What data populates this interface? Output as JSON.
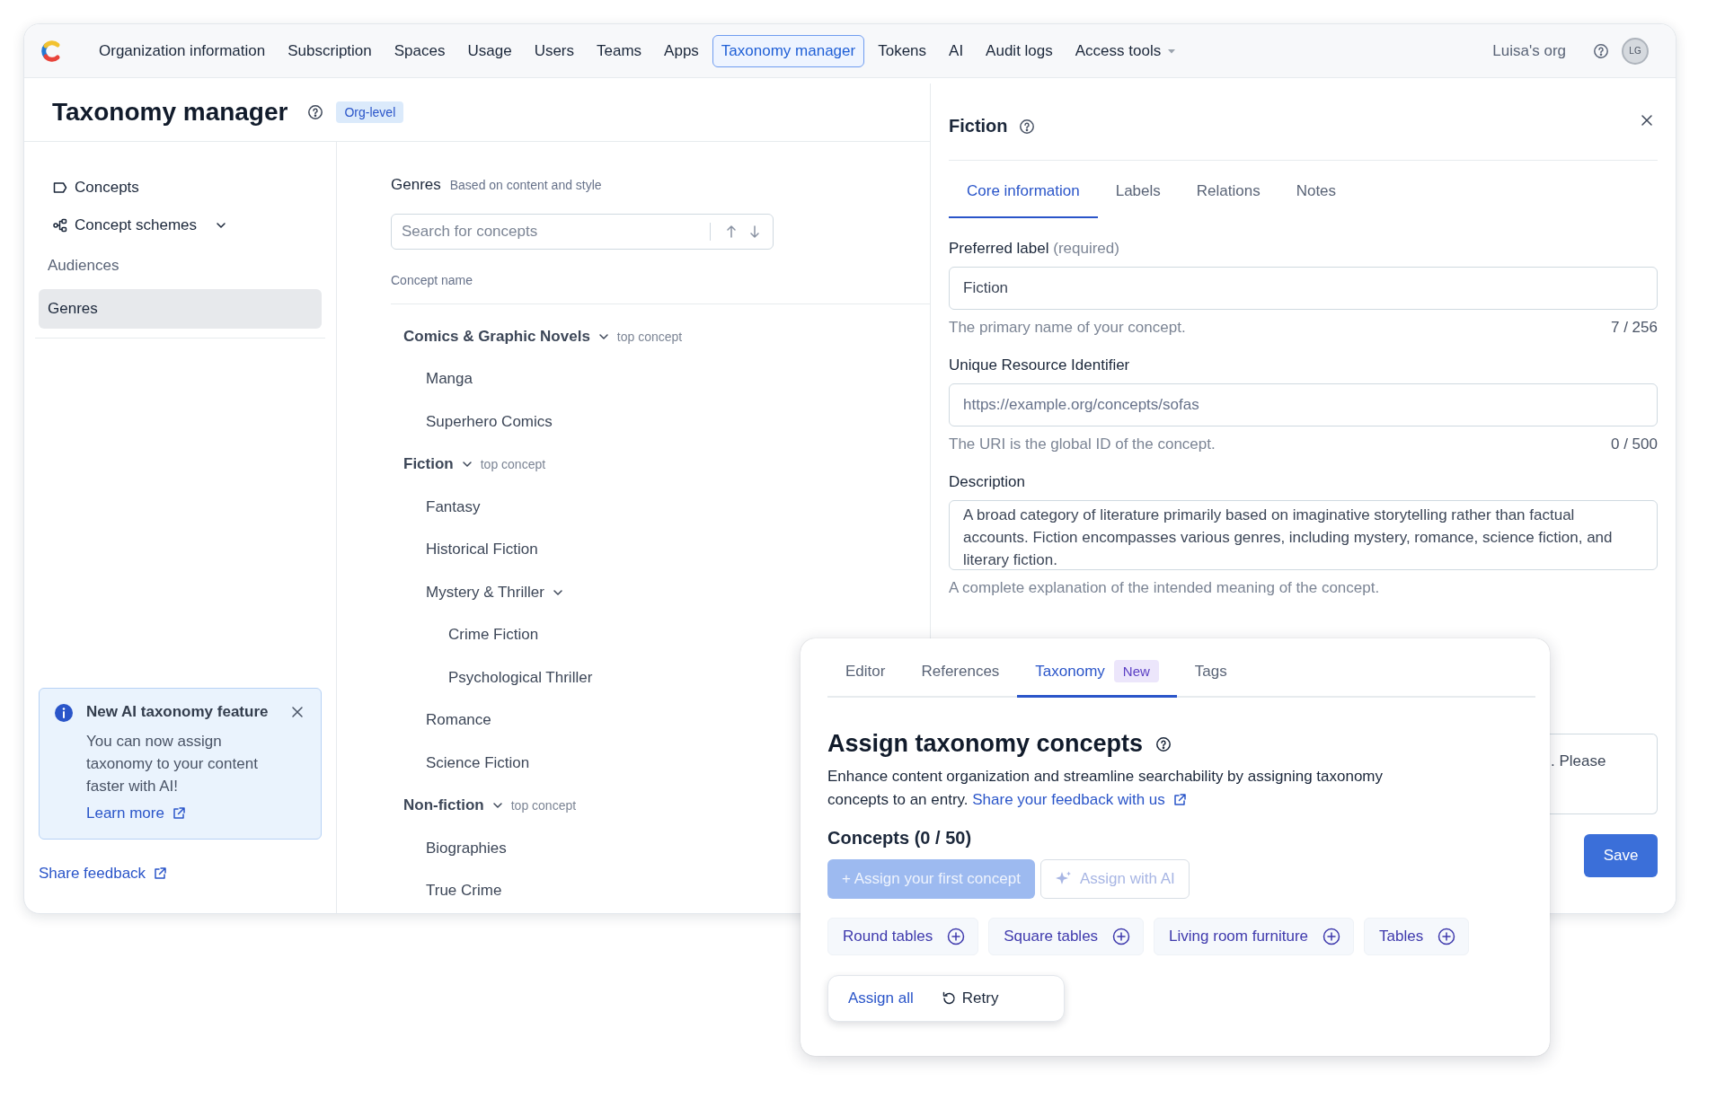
{
  "nav": {
    "items": [
      {
        "label": "Organization information",
        "selected": false,
        "menu": false
      },
      {
        "label": "Subscription",
        "selected": false,
        "menu": false
      },
      {
        "label": "Spaces",
        "selected": false,
        "menu": false
      },
      {
        "label": "Usage",
        "selected": false,
        "menu": false
      },
      {
        "label": "Users",
        "selected": false,
        "menu": false
      },
      {
        "label": "Teams",
        "selected": false,
        "menu": false
      },
      {
        "label": "Apps",
        "selected": false,
        "menu": false
      },
      {
        "label": "Taxonomy manager",
        "selected": true,
        "menu": false
      },
      {
        "label": "Tokens",
        "selected": false,
        "menu": false
      },
      {
        "label": "AI",
        "selected": false,
        "menu": false
      },
      {
        "label": "Audit logs",
        "selected": false,
        "menu": false
      },
      {
        "label": "Access tools",
        "selected": false,
        "menu": true
      }
    ],
    "org": "Luisa's org",
    "avatar": "LG"
  },
  "page": {
    "title": "Taxonomy manager",
    "badge": "Org-level"
  },
  "sidebar": {
    "items": [
      {
        "label": "Concepts",
        "kind": "concepts"
      },
      {
        "label": "Concept schemes",
        "kind": "schemes",
        "expanded": true
      }
    ],
    "schemes": [
      {
        "label": "Audiences",
        "selected": false
      },
      {
        "label": "Genres",
        "selected": true
      }
    ],
    "notice": {
      "title": "New AI taxonomy feature",
      "body": "You can now assign taxonomy to your content faster with AI!",
      "link": "Learn more"
    },
    "feedback": "Share feedback"
  },
  "scheme": {
    "title": "Genres",
    "subtitle": "Based on content and style",
    "search": {
      "placeholder": "Search for concepts"
    },
    "column": "Concept name",
    "concepts": [
      {
        "label": "Comics & Graphic Novels",
        "tag": "top concept",
        "expanded": true,
        "children": [
          {
            "label": "Manga"
          },
          {
            "label": "Superhero Comics"
          }
        ]
      },
      {
        "label": "Fiction",
        "tag": "top concept",
        "expanded": true,
        "children": [
          {
            "label": "Fantasy"
          },
          {
            "label": "Historical Fiction"
          },
          {
            "label": "Mystery & Thriller",
            "expanded": true,
            "children": [
              {
                "label": "Crime Fiction"
              },
              {
                "label": "Psychological Thriller"
              }
            ]
          },
          {
            "label": "Romance"
          },
          {
            "label": "Science Fiction"
          }
        ]
      },
      {
        "label": "Non-fiction",
        "tag": "top concept",
        "expanded": true,
        "children": [
          {
            "label": "Biographies"
          },
          {
            "label": "True Crime"
          }
        ]
      }
    ]
  },
  "detail": {
    "title": "Fiction",
    "tabs": [
      {
        "label": "Core information",
        "selected": true
      },
      {
        "label": "Labels",
        "selected": false
      },
      {
        "label": "Relations",
        "selected": false
      },
      {
        "label": "Notes",
        "selected": false
      }
    ],
    "fields": [
      {
        "kind": "input",
        "label": "Preferred label",
        "note": "(required)",
        "value": "Fiction",
        "help": "The primary name of your concept.",
        "count": "7 / 256"
      },
      {
        "kind": "input",
        "label": "Unique Resource Identifier",
        "placeholder": "https://example.org/concepts/sofas",
        "help": "The URI is the global ID of the concept.",
        "count": "0 / 500"
      },
      {
        "kind": "textarea",
        "label": "Description",
        "value": "A broad category of literature primarily based on imaginative storytelling rather than factual accounts. Fiction encompasses various genres, including mystery, romance, science fiction, and literary fiction.",
        "help": "A complete explanation of the intended meaning of the concept."
      }
    ],
    "partial_text": ". Please",
    "save": "Save"
  },
  "card": {
    "tabs": [
      {
        "label": "Editor",
        "selected": false
      },
      {
        "label": "References",
        "selected": false
      },
      {
        "label": "Taxonomy",
        "selected": true,
        "badge": "New"
      },
      {
        "label": "Tags",
        "selected": false
      }
    ],
    "title": "Assign taxonomy concepts",
    "description": "Enhance content organization and streamline searchability by assigning taxonomy concepts to an entry.",
    "link": "Share your feedback with us",
    "concepts_heading": "Concepts (0 / 50)",
    "assign_button": {
      "label": "+ Assign your first concept",
      "disabled": true
    },
    "ai_button": {
      "label": "Assign with AI",
      "disabled": true
    },
    "suggestions": [
      "Round tables",
      "Square tables",
      "Living room furniture",
      "Tables"
    ],
    "assign_all": "Assign all",
    "retry": "Retry"
  }
}
